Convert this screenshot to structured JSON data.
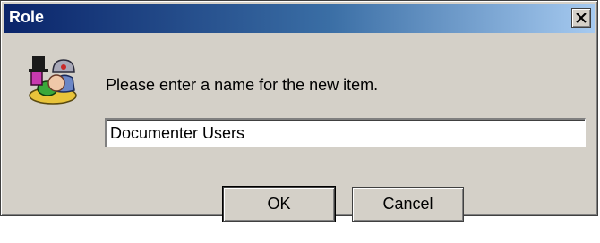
{
  "window": {
    "title": "Role",
    "close_glyph": "✕"
  },
  "icon": {
    "name": "role-icon"
  },
  "prompt": {
    "text": "Please enter a name for the new item."
  },
  "name_field": {
    "value": "Documenter Users"
  },
  "buttons": {
    "ok_label": "OK",
    "cancel_label": "Cancel"
  },
  "colors": {
    "titlebar_start": "#0a246a",
    "titlebar_end": "#a6caf0",
    "dialog_face": "#d4d0c8"
  }
}
